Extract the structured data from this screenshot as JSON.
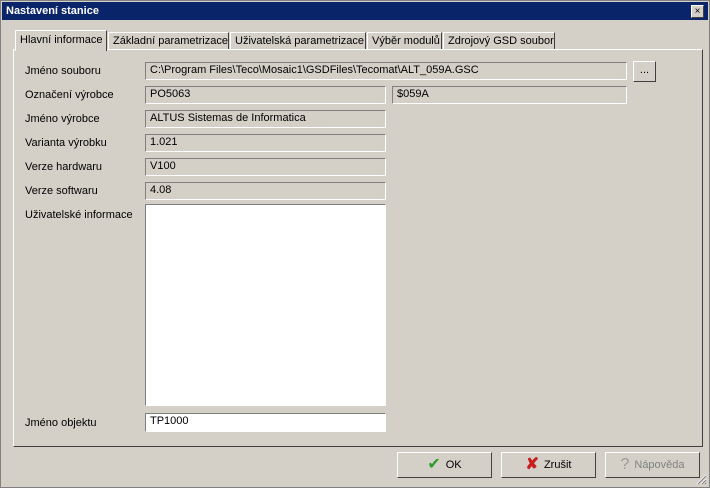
{
  "window": {
    "title": "Nastavení stanice",
    "close_label": "×"
  },
  "tabs": [
    {
      "label": "Hlavní informace"
    },
    {
      "label": "Základní parametrizace"
    },
    {
      "label": "Uživatelská parametrizace"
    },
    {
      "label": "Výběr modulů"
    },
    {
      "label": "Zdrojový GSD soubor"
    }
  ],
  "fields": {
    "file_name": {
      "label": "Jméno souboru",
      "value": "C:\\Program Files\\Teco\\Mosaic1\\GSDFiles\\Tecomat\\ALT_059A.GSC",
      "browse_label": "..."
    },
    "product_code": {
      "label": "Označení výrobce",
      "value": "PO5063",
      "value2": "$059A"
    },
    "vendor_name": {
      "label": "Jméno výrobce",
      "value": "ALTUS Sistemas de Informatica"
    },
    "product_variant": {
      "label": "Varianta výrobku",
      "value": "1.021"
    },
    "hw_version": {
      "label": "Verze hardwaru",
      "value": "V100"
    },
    "sw_version": {
      "label": "Verze softwaru",
      "value": "4.08"
    },
    "user_info": {
      "label": "Uživatelské informace",
      "value": ""
    },
    "object_name": {
      "label": "Jméno objektu",
      "value": "TP1000"
    }
  },
  "buttons": {
    "ok": {
      "label": "OK",
      "icon": "check-icon"
    },
    "cancel": {
      "label": "Zrušit",
      "icon": "x-icon"
    },
    "help": {
      "label": "Nápověda",
      "icon": "question-icon"
    }
  },
  "colors": {
    "titlebar": "#0a246a",
    "ok_icon": "#2e9c2e",
    "cancel_icon": "#c81e1e"
  }
}
